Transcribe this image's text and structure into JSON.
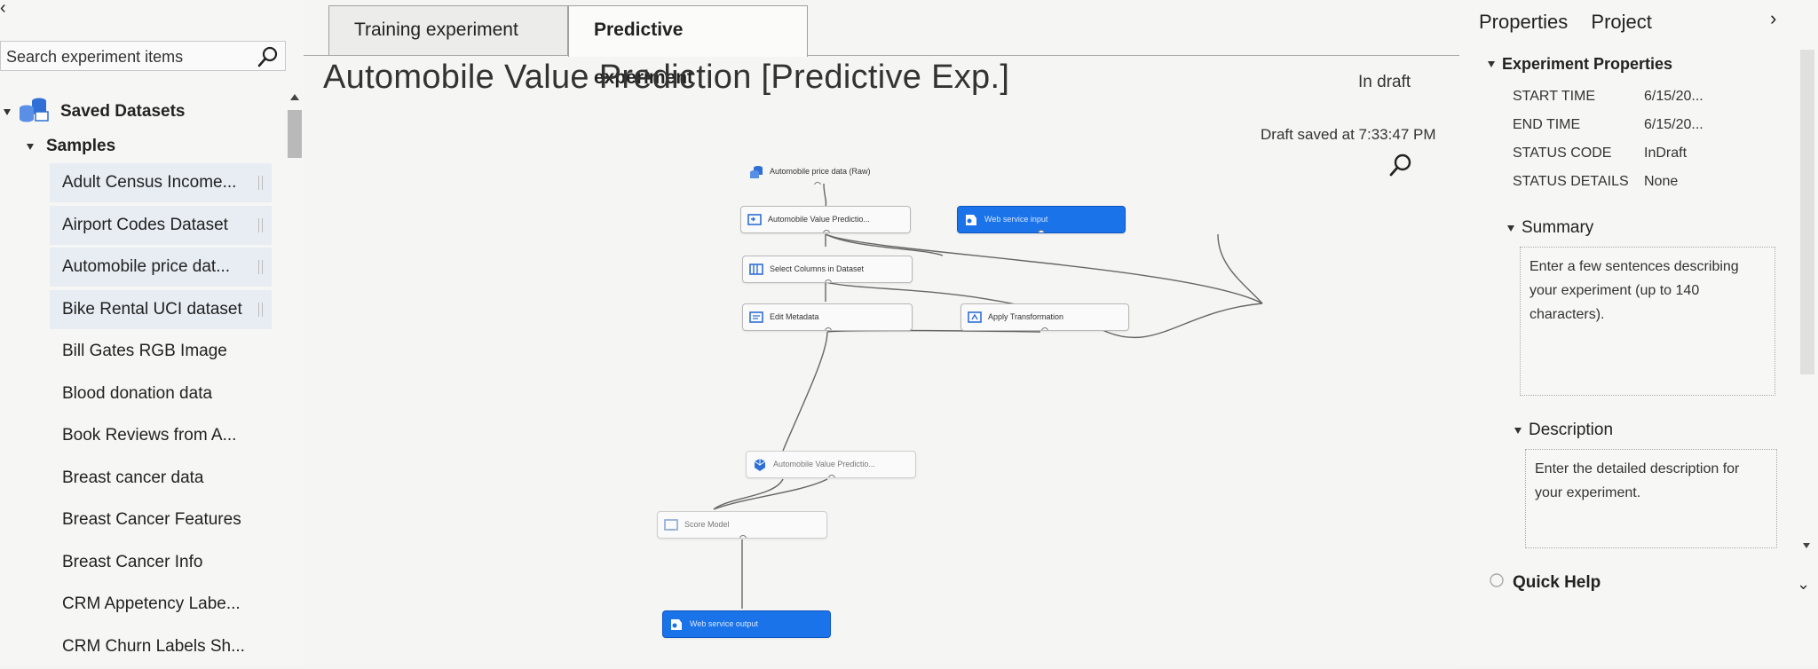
{
  "left_panel": {
    "collapse_glyph": "‹",
    "search": {
      "placeholder": "Search experiment items",
      "value": "",
      "icon": "search-icon"
    },
    "saved_datasets_label": "Saved Datasets",
    "samples_label": "Samples",
    "datasets": [
      "Adult Census Income...",
      "Airport Codes Dataset",
      "Automobile price dat...",
      "Bike Rental UCI dataset",
      "Bill Gates RGB Image",
      "Blood donation data",
      "Book Reviews from A...",
      "Breast cancer data",
      "Breast Cancer Features",
      "Breast Cancer Info",
      "CRM Appetency Labe...",
      "CRM Churn Labels Sh..."
    ]
  },
  "canvas": {
    "tabs": [
      {
        "label": "Training experiment",
        "active": false
      },
      {
        "label": "Predictive experiment",
        "active": true
      }
    ],
    "title": "Automobile Value Prediction [Predictive Exp.]",
    "status": "In draft",
    "draft_saved": "Draft saved at 7:33:47 PM",
    "accent_color": "#1a73e8",
    "nodes": {
      "raw_data": "Automobile price data (Raw)",
      "model_top": "Automobile Value Predictio...",
      "web_input": "Web service input",
      "select_columns": "Select Columns in Dataset",
      "edit_metadata": "Edit Metadata",
      "apply_transformation": "Apply Transformation",
      "model_bottom": "Automobile Value Predictio...",
      "score_model": "Score Model",
      "web_output": "Web service output"
    }
  },
  "right_panel": {
    "tabs": [
      "Properties",
      "Project"
    ],
    "collapse_glyph": "›",
    "experiment_properties_label": "Experiment Properties",
    "properties": [
      {
        "key": "START TIME",
        "value": "6/15/20..."
      },
      {
        "key": "END TIME",
        "value": "6/15/20..."
      },
      {
        "key": "STATUS CODE",
        "value": "InDraft"
      },
      {
        "key": "STATUS DETAILS",
        "value": "None"
      }
    ],
    "summary_label": "Summary",
    "summary_placeholder": "Enter a few sentences describing your experiment (up to 140 characters).",
    "description_label": "Description",
    "description_placeholder": "Enter the detailed description for your experiment.",
    "quick_help_label": "Quick Help"
  }
}
